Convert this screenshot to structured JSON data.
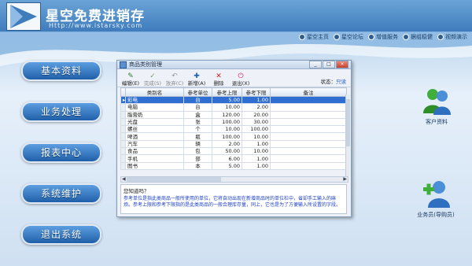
{
  "app": {
    "title": "星空免费进销存",
    "url": "Http://www.istarsky.com"
  },
  "topnav": [
    {
      "label": "星空主页"
    },
    {
      "label": "星空论坛"
    },
    {
      "label": "增值服务"
    },
    {
      "label": "据组稳健"
    },
    {
      "label": "视频演示"
    }
  ],
  "menu": [
    {
      "label": "基本资料"
    },
    {
      "label": "业务处理"
    },
    {
      "label": "报表中心"
    },
    {
      "label": "系统维护"
    },
    {
      "label": "退出系统"
    }
  ],
  "side": {
    "customer_label": "客户资料",
    "salesman_label": "业务员(导购员)"
  },
  "dialog": {
    "title": "商品类别管理",
    "toolbar": [
      {
        "label": "编辑(E)",
        "icon": "edit-icon",
        "enabled": true
      },
      {
        "label": "完成(S)",
        "icon": "check-icon",
        "enabled": false
      },
      {
        "label": "放弃(C)",
        "icon": "undo-icon",
        "enabled": false
      },
      {
        "label": "新增(A)",
        "icon": "plus-icon",
        "enabled": true
      },
      {
        "label": "删除",
        "icon": "delete-icon",
        "enabled": true
      },
      {
        "label": "退出(X)",
        "icon": "exit-icon",
        "enabled": true
      }
    ],
    "status_label": "状态：",
    "status_value": "只读",
    "columns": [
      "类别名",
      "参考单位",
      "参考上限",
      "参考下限",
      "备注"
    ],
    "rows": [
      {
        "name": "彩电",
        "unit": "台",
        "upper": "5.00",
        "lower": "1.00",
        "note": "",
        "selected": true
      },
      {
        "name": "电脑",
        "unit": "台",
        "upper": "10.00",
        "lower": "2.00",
        "note": ""
      },
      {
        "name": "脂膏奶",
        "unit": "盒",
        "upper": "120.00",
        "lower": "20.00",
        "note": ""
      },
      {
        "name": "光盘",
        "unit": "张",
        "upper": "100.00",
        "lower": "30.00",
        "note": ""
      },
      {
        "name": "螺丝",
        "unit": "个",
        "upper": "10.00",
        "lower": "100.00",
        "note": ""
      },
      {
        "name": "啤酒",
        "unit": "瓶",
        "upper": "100.00",
        "lower": "10.00",
        "note": ""
      },
      {
        "name": "汽车",
        "unit": "辆",
        "upper": "2.00",
        "lower": "1.00",
        "note": ""
      },
      {
        "name": "食品",
        "unit": "包",
        "upper": "50.00",
        "lower": "10.00",
        "note": ""
      },
      {
        "name": "手机",
        "unit": "部",
        "upper": "6.00",
        "lower": "1.00",
        "note": ""
      },
      {
        "name": "图书",
        "unit": "本",
        "upper": "5.00",
        "lower": "1.00",
        "note": ""
      }
    ],
    "hint_title": "您知道吗？",
    "hint_text": "参考单位是指此类商品一般所使用的单位，它将自动出现在新增商品时的单位栏中，省却手工输入的麻烦。参考上限和参考下限指的是此类商品的一般合理库存量，同上，它也是为了方便输入所设置的字段。"
  },
  "colors": {
    "header_blue": "#3f7cbc",
    "menu_blue": "#1f5fa8",
    "selection": "#2e6fd1",
    "hint_text": "#1a3fc0"
  }
}
